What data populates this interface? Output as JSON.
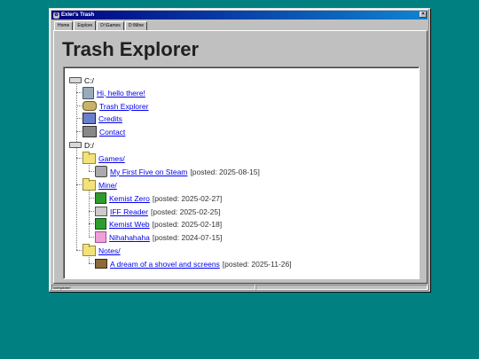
{
  "window": {
    "title": "Exler's Trash",
    "close_label": "×"
  },
  "tabs": [
    {
      "label": "Home"
    },
    {
      "label": "Explore"
    },
    {
      "label": "D:\\Games"
    },
    {
      "label": "D:\\Mine"
    }
  ],
  "page_title": "Trash Explorer",
  "tree": {
    "c_drive": "C:/",
    "c_items": [
      {
        "label": "Hi, hello there!",
        "icon": "recycle-bin-icon"
      },
      {
        "label": "Trash Explorer",
        "icon": "trash-explorer-icon"
      },
      {
        "label": "Credits",
        "icon": "credits-icon"
      },
      {
        "label": "Contact",
        "icon": "contact-icon"
      }
    ],
    "d_drive": "D:/",
    "games_folder": "Games/",
    "games_items": [
      {
        "label": "My First Five on Steam",
        "meta": "[posted: 2025-08-15]",
        "icon": "steam-icon"
      }
    ],
    "mine_folder": "Mine/",
    "mine_items": [
      {
        "label": "Kemist Zero",
        "meta": "[posted: 2025-02-27]",
        "icon": "kemist-icon"
      },
      {
        "label": "IFF Reader",
        "meta": "[posted: 2025-02-25]",
        "icon": "iff-reader-icon"
      },
      {
        "label": "Kemist Web",
        "meta": "[posted: 2025-02-18]",
        "icon": "kemist-icon"
      },
      {
        "label": "Nihahahaha",
        "meta": "[posted: 2024-07-15]",
        "icon": "pink-pig-icon"
      }
    ],
    "notes_folder": "Notes/",
    "notes_items": [
      {
        "label": "A dream of a shovel and screens",
        "meta": "[posted: 2025-11-26]",
        "icon": "shovel-icon"
      }
    ]
  },
  "statusbar": {
    "path": "/c/explorer/"
  }
}
